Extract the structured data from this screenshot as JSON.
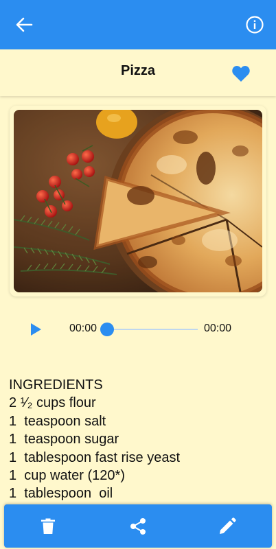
{
  "colors": {
    "primary": "#2B8DF0",
    "background": "#FFF8CC",
    "text": "#111111",
    "track": "#BFD7EE"
  },
  "appbar": {
    "back_icon": "arrow-back-icon",
    "info_icon": "info-circle-icon"
  },
  "recipe": {
    "title": "Pizza",
    "favorite": true,
    "favorite_icon": "heart-filled-icon",
    "image_description": "pizza-photo"
  },
  "player": {
    "play_icon": "play-icon",
    "current_time": "00:00",
    "total_time": "00:00",
    "progress": 0
  },
  "ingredients": {
    "lines": [
      "INGREDIENTS",
      "2 ¹⁄₂ cups flour",
      "1  teaspoon salt",
      "1  teaspoon sugar",
      "1  tablespoon fast rise yeast",
      "1  cup water (120*)",
      "1  tablespoon  oil"
    ]
  },
  "actions": {
    "delete_icon": "trash-icon",
    "share_icon": "share-icon",
    "edit_icon": "pencil-icon"
  }
}
